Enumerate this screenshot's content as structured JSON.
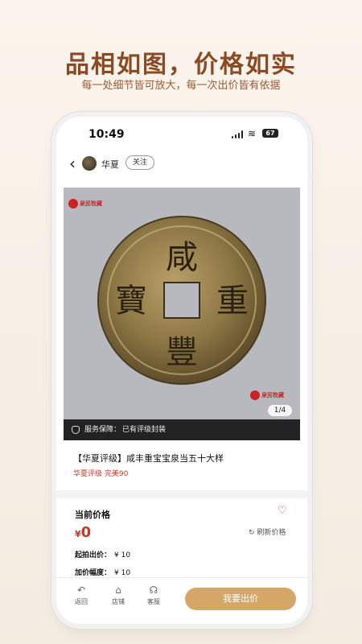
{
  "headline": "品相如图，价格如实",
  "subline": "每一处细节皆可放大，每一次出价皆有依据",
  "status": {
    "time": "10:49",
    "battery": "67"
  },
  "shop": {
    "name": "华夏",
    "follow_label": "关注"
  },
  "gallery": {
    "watermark_text": "泉民牧藏",
    "counter": "1/4",
    "coin_chars": {
      "top": "咸",
      "right": "重",
      "bottom": "豐",
      "left": "寶"
    }
  },
  "service": {
    "label": "服务保障：",
    "value": "已有评级封装"
  },
  "item": {
    "title": "【华夏评级】咸丰重宝宝泉当五十大样",
    "grade": "华夏评级 完美90"
  },
  "price": {
    "label": "当前价格",
    "currency": "¥",
    "value": "0",
    "refresh_label": "刷新价格",
    "start_label": "起拍出价：",
    "start_value": "¥ 10",
    "increment_label": "加价幅度：",
    "increment_value": "¥ 10"
  },
  "bottom": {
    "back_label": "返回",
    "shop_label": "店铺",
    "service_label": "客服",
    "bid_label": "我要出价"
  },
  "colors": {
    "accent": "#c0392b",
    "bid_button": "#d4a668",
    "headline": "#8a4a24"
  }
}
